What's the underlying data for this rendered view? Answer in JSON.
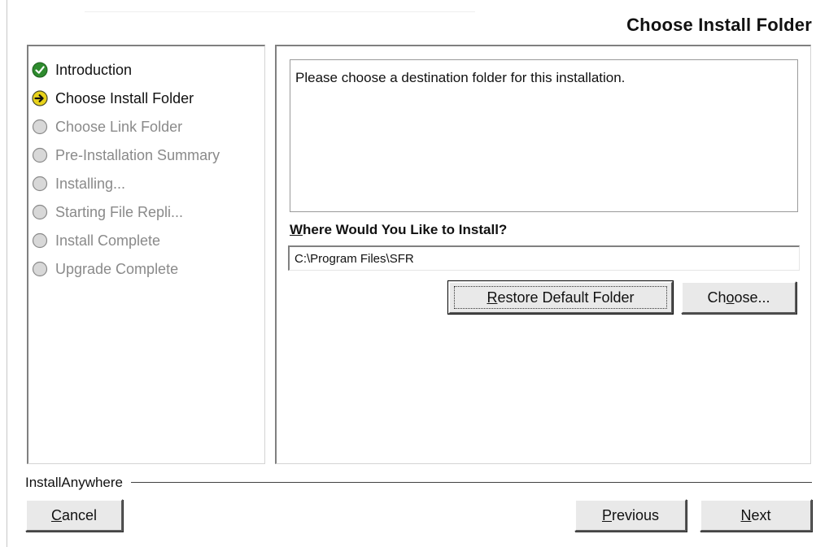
{
  "header": {
    "title": "Choose Install Folder"
  },
  "steps": [
    {
      "label": "Introduction",
      "state": "done",
      "icon": "check-icon"
    },
    {
      "label": "Choose Install Folder",
      "state": "current",
      "icon": "arrow-right-icon"
    },
    {
      "label": "Choose Link Folder",
      "state": "pending",
      "icon": "circle-icon"
    },
    {
      "label": "Pre-Installation Summary",
      "state": "pending",
      "icon": "circle-icon"
    },
    {
      "label": "Installing...",
      "state": "pending",
      "icon": "circle-icon"
    },
    {
      "label": "Starting File Repli...",
      "state": "pending",
      "icon": "circle-icon"
    },
    {
      "label": "Install Complete",
      "state": "pending",
      "icon": "circle-icon"
    },
    {
      "label": "Upgrade Complete",
      "state": "pending",
      "icon": "circle-icon"
    }
  ],
  "content": {
    "message": "Please choose a destination folder for this installation.",
    "install_label_mnemonic": "W",
    "install_label_rest": "here Would You Like to Install?",
    "install_path": "C:\\Program Files\\SFR",
    "restore_button_mnemonic": "R",
    "restore_button_rest": "estore Default Folder",
    "choose_button_pre": "Ch",
    "choose_button_mnemonic": "o",
    "choose_button_post": "ose..."
  },
  "footer": {
    "brand": "InstallAnywhere",
    "cancel_mnemonic": "C",
    "cancel_rest": "ancel",
    "previous_mnemonic": "P",
    "previous_rest": "revious",
    "next_mnemonic": "N",
    "next_rest": "ext"
  },
  "colors": {
    "done_icon": "#2e8b2e",
    "current_icon": "#e8d21a",
    "pending_icon": "#d8d8d8",
    "pending_text": "#8a8a8a"
  }
}
